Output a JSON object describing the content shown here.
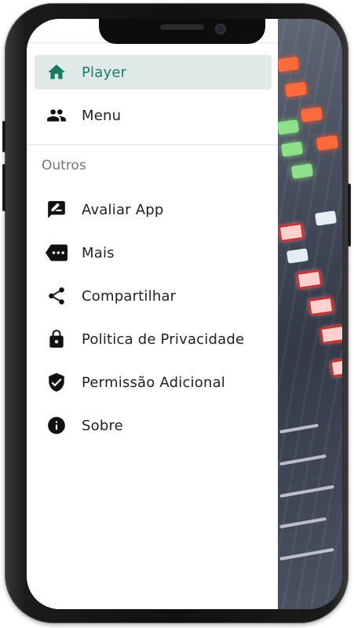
{
  "drawer": {
    "primary_items": [
      {
        "label": "Player",
        "icon": "home-icon",
        "active": true
      },
      {
        "label": "Menu",
        "icon": "people-icon",
        "active": false
      }
    ],
    "section_title": "Outros",
    "other_items": [
      {
        "label": "Avaliar App",
        "icon": "rate-review-icon"
      },
      {
        "label": "Mais",
        "icon": "more-tag-icon"
      },
      {
        "label": "Compartilhar",
        "icon": "share-icon"
      },
      {
        "label": "Politica de Privacidade",
        "icon": "lock-icon"
      },
      {
        "label": "Permissão Adicional",
        "icon": "verified-shield-icon"
      },
      {
        "label": "Sobre",
        "icon": "info-icon"
      }
    ]
  },
  "colors": {
    "accent": "#1b7a64",
    "active_bg": "#dfe9e7",
    "icon": "#111111"
  }
}
